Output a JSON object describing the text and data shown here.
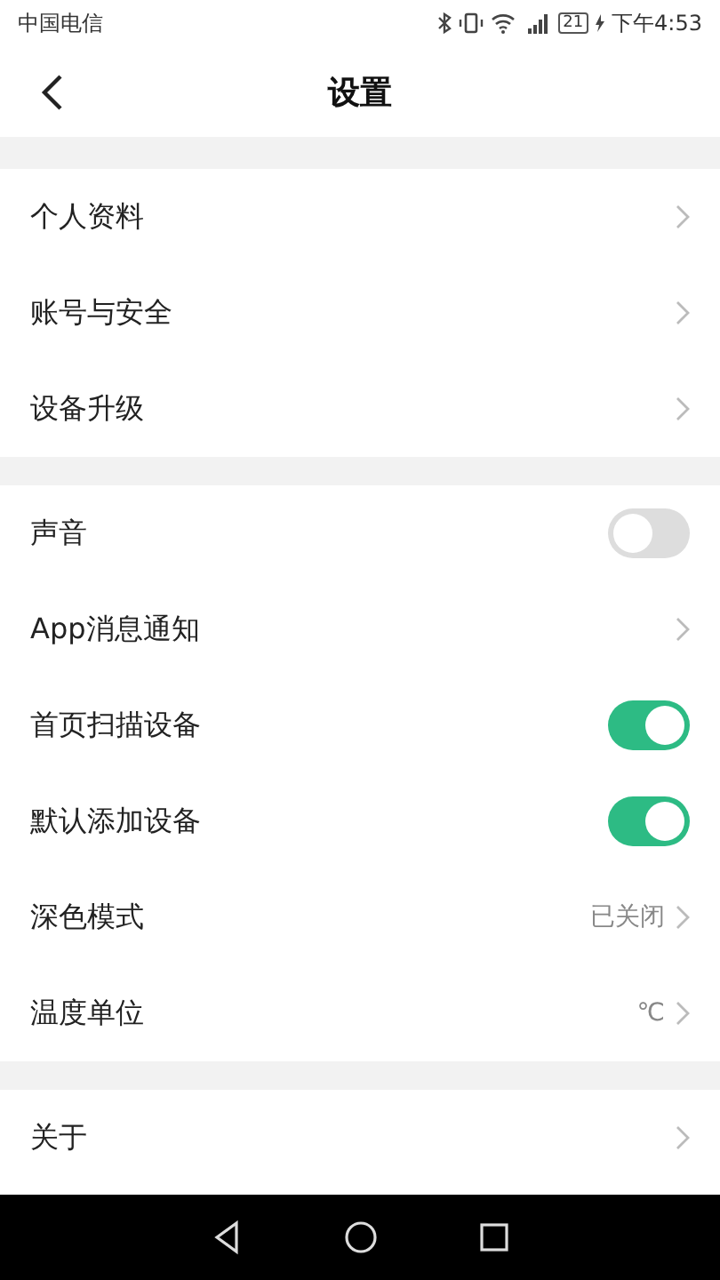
{
  "status_bar": {
    "carrier": "中国电信",
    "battery": "21",
    "time": "下午4:53"
  },
  "header": {
    "title": "设置"
  },
  "sections": [
    {
      "items": [
        {
          "kind": "link",
          "label": "个人资料"
        },
        {
          "kind": "link",
          "label": "账号与安全"
        },
        {
          "kind": "link",
          "label": "设备升级"
        }
      ]
    },
    {
      "items": [
        {
          "kind": "toggle",
          "label": "声音",
          "on": false
        },
        {
          "kind": "link",
          "label": "App消息通知"
        },
        {
          "kind": "toggle",
          "label": "首页扫描设备",
          "on": true
        },
        {
          "kind": "toggle",
          "label": "默认添加设备",
          "on": true
        },
        {
          "kind": "link",
          "label": "深色模式",
          "value": "已关闭"
        },
        {
          "kind": "link",
          "label": "温度单位",
          "value": "℃"
        }
      ]
    },
    {
      "items": [
        {
          "kind": "link",
          "label": "关于"
        }
      ]
    }
  ]
}
